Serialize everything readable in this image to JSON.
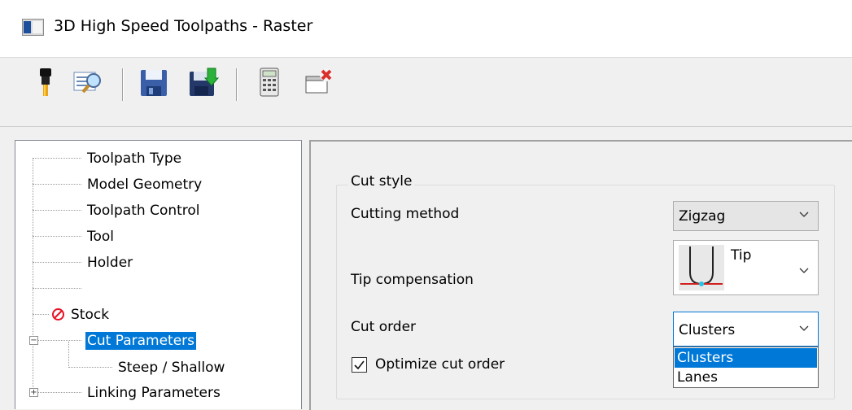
{
  "window": {
    "title": "3D High Speed Toolpaths - Raster"
  },
  "toolbar": {
    "buttons": [
      {
        "name": "tool-icon"
      },
      {
        "name": "preview-icon"
      },
      {
        "name": "save-icon"
      },
      {
        "name": "save-load-icon"
      },
      {
        "name": "calculator-icon"
      },
      {
        "name": "close-window-icon"
      }
    ]
  },
  "tree": {
    "items": [
      {
        "label": "Toolpath Type"
      },
      {
        "label": "Model Geometry"
      },
      {
        "label": "Toolpath Control"
      },
      {
        "label": "Tool"
      },
      {
        "label": "Holder"
      },
      {
        "label": ""
      },
      {
        "label": "Stock",
        "status_icon": "error-circle-icon"
      },
      {
        "label": "Cut Parameters",
        "selected": true,
        "expander": "−"
      },
      {
        "label": "Steep / Shallow"
      },
      {
        "label": "Linking Parameters",
        "expander": "+"
      }
    ]
  },
  "cut_style": {
    "legend": "Cut style",
    "cutting_method": {
      "label": "Cutting method",
      "value": "Zigzag"
    },
    "tip_compensation": {
      "label": "Tip compensation",
      "value": "Tip"
    },
    "cut_order": {
      "label": "Cut order",
      "value": "Clusters",
      "options": [
        "Clusters",
        "Lanes"
      ],
      "highlighted_option": "Clusters"
    },
    "optimize": {
      "label": "Optimize cut order",
      "checked": true
    }
  },
  "colors": {
    "selection": "#0078d7",
    "error": "#e81123"
  }
}
